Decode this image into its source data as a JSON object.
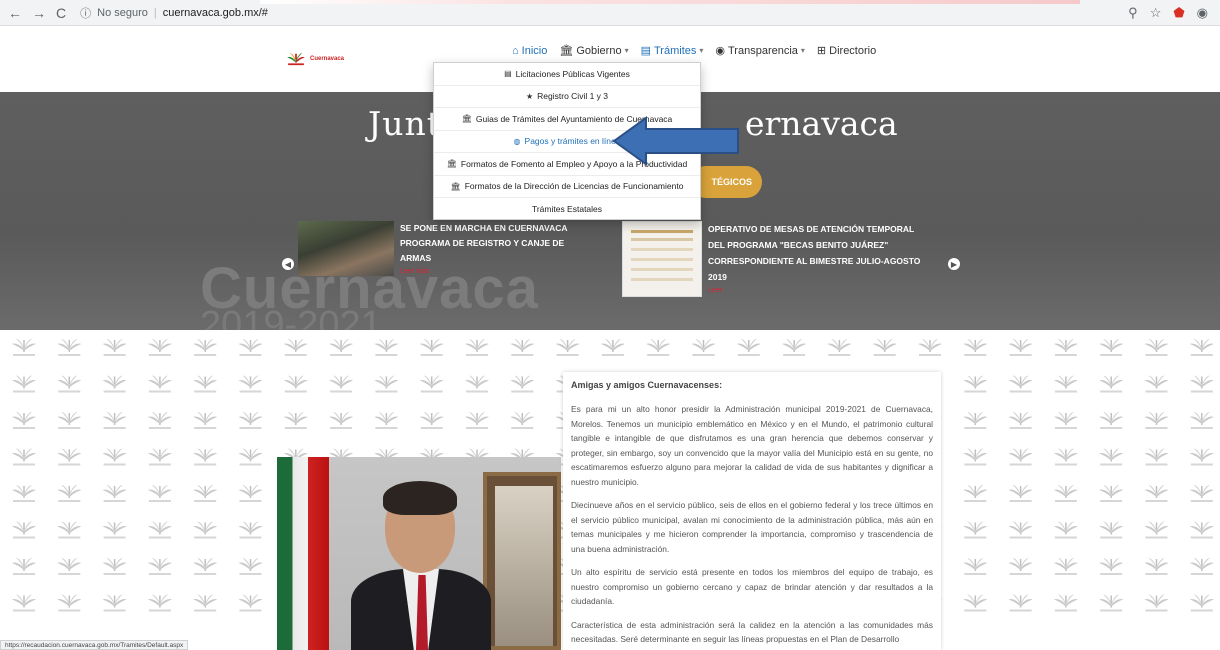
{
  "browser": {
    "security_label": "No seguro",
    "url": "cuernavaca.gob.mx/#",
    "status_url": "https://recaudacion.cuernavaca.gob.mx/Tramites/Default.aspx"
  },
  "header": {
    "logo_text": "Cuernavaca",
    "nav": [
      {
        "label": "Inicio",
        "icon": "home-icon"
      },
      {
        "label": "Gobierno",
        "icon": "bank-icon"
      },
      {
        "label": "Trámites",
        "icon": "list-icon"
      },
      {
        "label": "Transparencia",
        "icon": "eye-icon"
      },
      {
        "label": "Directorio",
        "icon": "sitemap-icon"
      }
    ]
  },
  "dropdown": {
    "items": [
      {
        "label": "Licitaciones Públicas Vigentes",
        "icon": "list-icon"
      },
      {
        "label": "Registro Civil 1 y 3",
        "icon": "star-icon"
      },
      {
        "label": "Guias de Trámites del Ayuntamiento de Cuernavaca",
        "icon": "bank-icon"
      },
      {
        "label": "Pagos y trámites en línea",
        "icon": "globe-icon"
      },
      {
        "label": "Formatos de Fomento al Empleo y Apoyo a la Productividad",
        "icon": "bank-icon"
      },
      {
        "label": "Formatos de la Dirección de Licencias de Funcionamiento",
        "icon": "bank-icon"
      },
      {
        "label": "Trámites Estatales",
        "icon": ""
      }
    ]
  },
  "hero": {
    "title_left": "Junt",
    "title_right": "ernavaca",
    "bg_text_1": "Cuernavaca",
    "bg_text_2": "2019-2021",
    "button_label": "TÉGICOS",
    "news": [
      {
        "title": "SE PONE EN MARCHA EN CUERNAVACA PROGRAMA DE REGISTRO Y CANJE DE ARMAS",
        "subtitle": "Leer más"
      },
      {
        "title": "OPERATIVO DE MESAS DE ATENCIÓN TEMPORAL DEL PROGRAMA \"BECAS BENITO JUÁREZ\" CORRESPONDIENTE AL BIMESTRE JULIO-AGOSTO 2019",
        "subtitle": "Leer"
      }
    ]
  },
  "message": {
    "greeting": "Amigas y amigos Cuernavacenses:",
    "paragraphs": [
      "Es para mi un alto honor presidir la Administración municipal 2019-2021 de Cuernavaca, Morelos. Tenemos un municipio emblemático en México y en el Mundo, el patrimonio cultural tangible e intangible de que disfrutamos es una gran herencia que debemos conservar y proteger, sin embargo, soy un convencido que la mayor valía del Municipio está en su gente, no escatimaremos esfuerzo alguno para mejorar la calidad de vida de sus habitantes y dignificar a nuestro municipio.",
      "Diecinueve años en el servicio público, seis de ellos en el gobierno federal y los trece últimos en el servicio público municipal, avalan mi conocimiento de la administración pública, más aún en temas municipales y me hicieron comprender la importancia, compromiso y trascendencia de una buena administración.",
      "Un alto espíritu de servicio está presente en todos los miembros del equipo de trabajo, es nuestro compromiso un gobierno cercano y capaz de brindar atención y dar resultados a la ciudadanía.",
      "Característica de esta administración será la calidez en la atención a las comunidades más necesitadas. Seré determinante en seguir las líneas propuestas en el Plan de Desarrollo"
    ]
  },
  "colors": {
    "accent": "#1f6fb8",
    "gold": "#d9a23a",
    "brand_red": "#c22222",
    "arrow": "#3c6fb4"
  }
}
